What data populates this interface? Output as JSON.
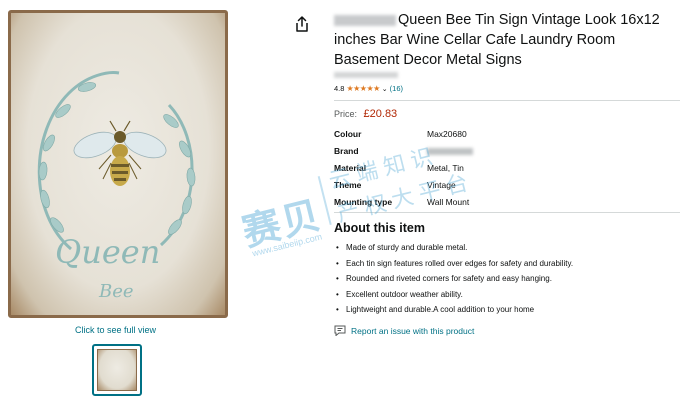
{
  "gallery": {
    "image_text_main": "Queen",
    "image_text_sub": "Bee",
    "full_view_link": "Click to see full view"
  },
  "product": {
    "title": "Queen Bee Tin Sign Vintage Look 16x12 inches Bar Wine Cellar Cafe Laundry Room Basement Decor Metal Signs",
    "rating_value": "4.8",
    "rating_count": "(16)",
    "price_label": "Price:",
    "price": "£20.83"
  },
  "specs": [
    {
      "key": "Colour",
      "value": "Max20680"
    },
    {
      "key": "Brand",
      "value": ""
    },
    {
      "key": "Material",
      "value": "Metal, Tin"
    },
    {
      "key": "Theme",
      "value": "Vintage"
    },
    {
      "key": "Mounting type",
      "value": "Wall Mount"
    }
  ],
  "about": {
    "heading": "About this item",
    "bullets": [
      "Made of sturdy and durable metal.",
      "Each tin sign features rolled over edges for safety and durability.",
      "Rounded and riveted corners for safety and easy hanging.",
      "Excellent outdoor weather ability.",
      "Lightweight and durable.A cool addition to your home"
    ]
  },
  "report_link": "Report an issue with this product",
  "watermark": {
    "brand": "赛贝",
    "line1": "云端知识",
    "line2": "产权大平台",
    "url": "www.saibeiip.com"
  },
  "icons": {
    "share": "share-icon",
    "star": "star-icon",
    "chevron": "chevron-down-icon",
    "report": "report-icon",
    "thumbnail": "thumbnail-image"
  },
  "colors": {
    "price": "#b12704",
    "link": "#007185",
    "stars": "#de7921",
    "watermark": "#52a8d6"
  }
}
